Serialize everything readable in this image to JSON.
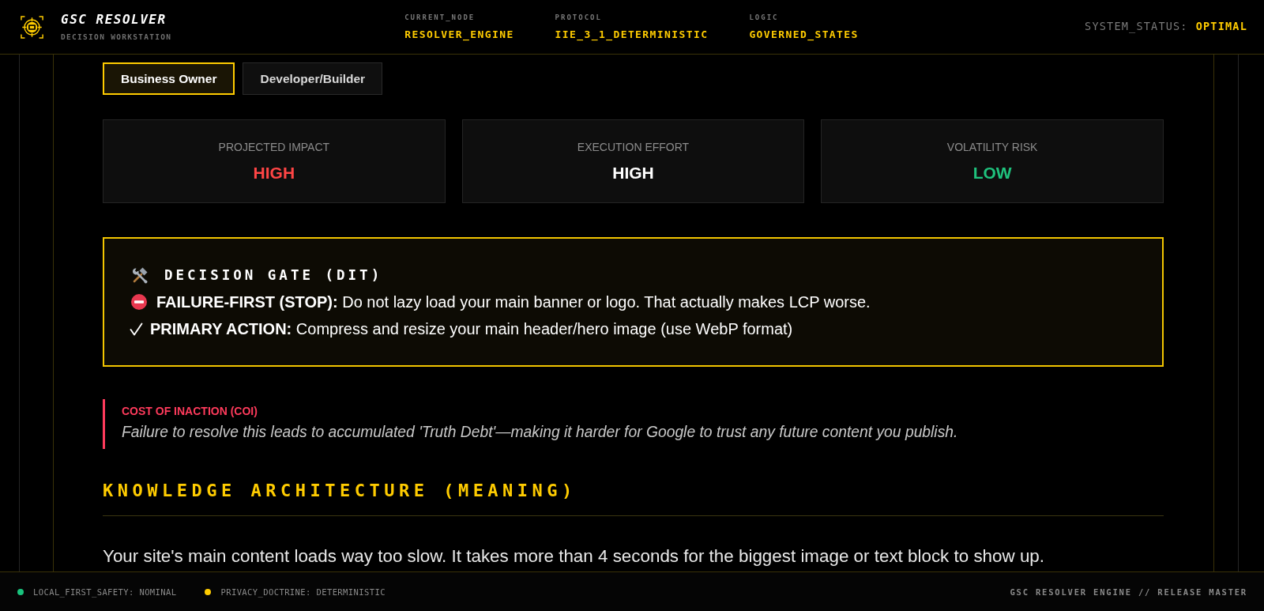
{
  "header": {
    "title": "GSC RESOLVER",
    "subtitle": "DECISION WORKSTATION",
    "meta": [
      {
        "label": "CURRENT_NODE",
        "value": "RESOLVER_ENGINE"
      },
      {
        "label": "PROTOCOL",
        "value": "IIE_3_1_DETERMINISTIC"
      },
      {
        "label": "LOGIC",
        "value": "GOVERNED_STATES"
      }
    ],
    "status": {
      "label": "SYSTEM_STATUS:",
      "value": "OPTIMAL"
    }
  },
  "tabs": [
    {
      "label": "Business Owner",
      "selected": true
    },
    {
      "label": "Developer/Builder",
      "selected": false
    }
  ],
  "cards": [
    {
      "label": "PROJECTED IMPACT",
      "value": "HIGH",
      "color": "#ff4545"
    },
    {
      "label": "EXECUTION EFFORT",
      "value": "HIGH",
      "color": "#ffffff"
    },
    {
      "label": "VOLATILITY RISK",
      "value": "LOW",
      "color": "#1fc27d"
    }
  ],
  "decision_gate": {
    "title": "DECISION GATE (DIT)",
    "rows": [
      {
        "kind": "stop",
        "text": "**FAILURE-FIRST (STOP):** Do not lazy load your main banner or logo. That actually makes LCP worse."
      },
      {
        "kind": "check",
        "text": "**PRIMARY ACTION:** Compress and resize your main header/hero image (use WebP format)"
      }
    ]
  },
  "cost_of_inaction": {
    "label": "COST OF INACTION (COI)",
    "text": "Failure to resolve this leads to accumulated 'Truth Debt'—making it harder for Google to trust any future content you publish."
  },
  "section": {
    "heading": "KNOWLEDGE ARCHITECTURE (MEANING)",
    "paragraph": "Your site's main content loads way too slow. It takes more than 4 seconds for the biggest image or text block to show up."
  },
  "footer": {
    "indicators": [
      {
        "label": "LOCAL_FIRST_SAFETY: NOMINAL",
        "color": "#19c37d"
      },
      {
        "label": "PRIVACY_DOCTRINE: DETERMINISTIC",
        "color": "#ffcc00"
      }
    ],
    "credit": "GSC RESOLVER ENGINE // RELEASE MASTER"
  }
}
